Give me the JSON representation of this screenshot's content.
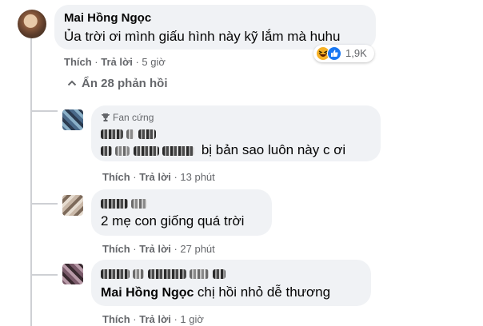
{
  "main_comment": {
    "author": "Mai Hồng Ngọc",
    "text": "Ủa trời ơi mình giấu hình này kỹ lắm mà huhu",
    "like_label": "Thích",
    "reply_label": "Trả lời",
    "time": "5 giờ",
    "reaction_count": "1,9K",
    "reaction_icons": [
      "haha-icon",
      "like-icon"
    ]
  },
  "hide_replies": {
    "icon": "chevron-up-icon",
    "label": "Ẩn 28 phản hồi"
  },
  "replies": [
    {
      "badge": "Fan cứng",
      "badge_icon": "trophy-icon",
      "text": "bị bản sao luôn này c ơi",
      "like_label": "Thích",
      "reply_label": "Trả lời",
      "time": "13 phút"
    },
    {
      "text": "2 mẹ con giống quá trời",
      "like_label": "Thích",
      "reply_label": "Trả lời",
      "time": "27 phút"
    },
    {
      "tag": "Mai Hồng Ngọc",
      "text": "chị hồi nhỏ dễ thương",
      "like_label": "Thích",
      "reply_label": "Trả lời",
      "time": "1 giờ"
    }
  ]
}
